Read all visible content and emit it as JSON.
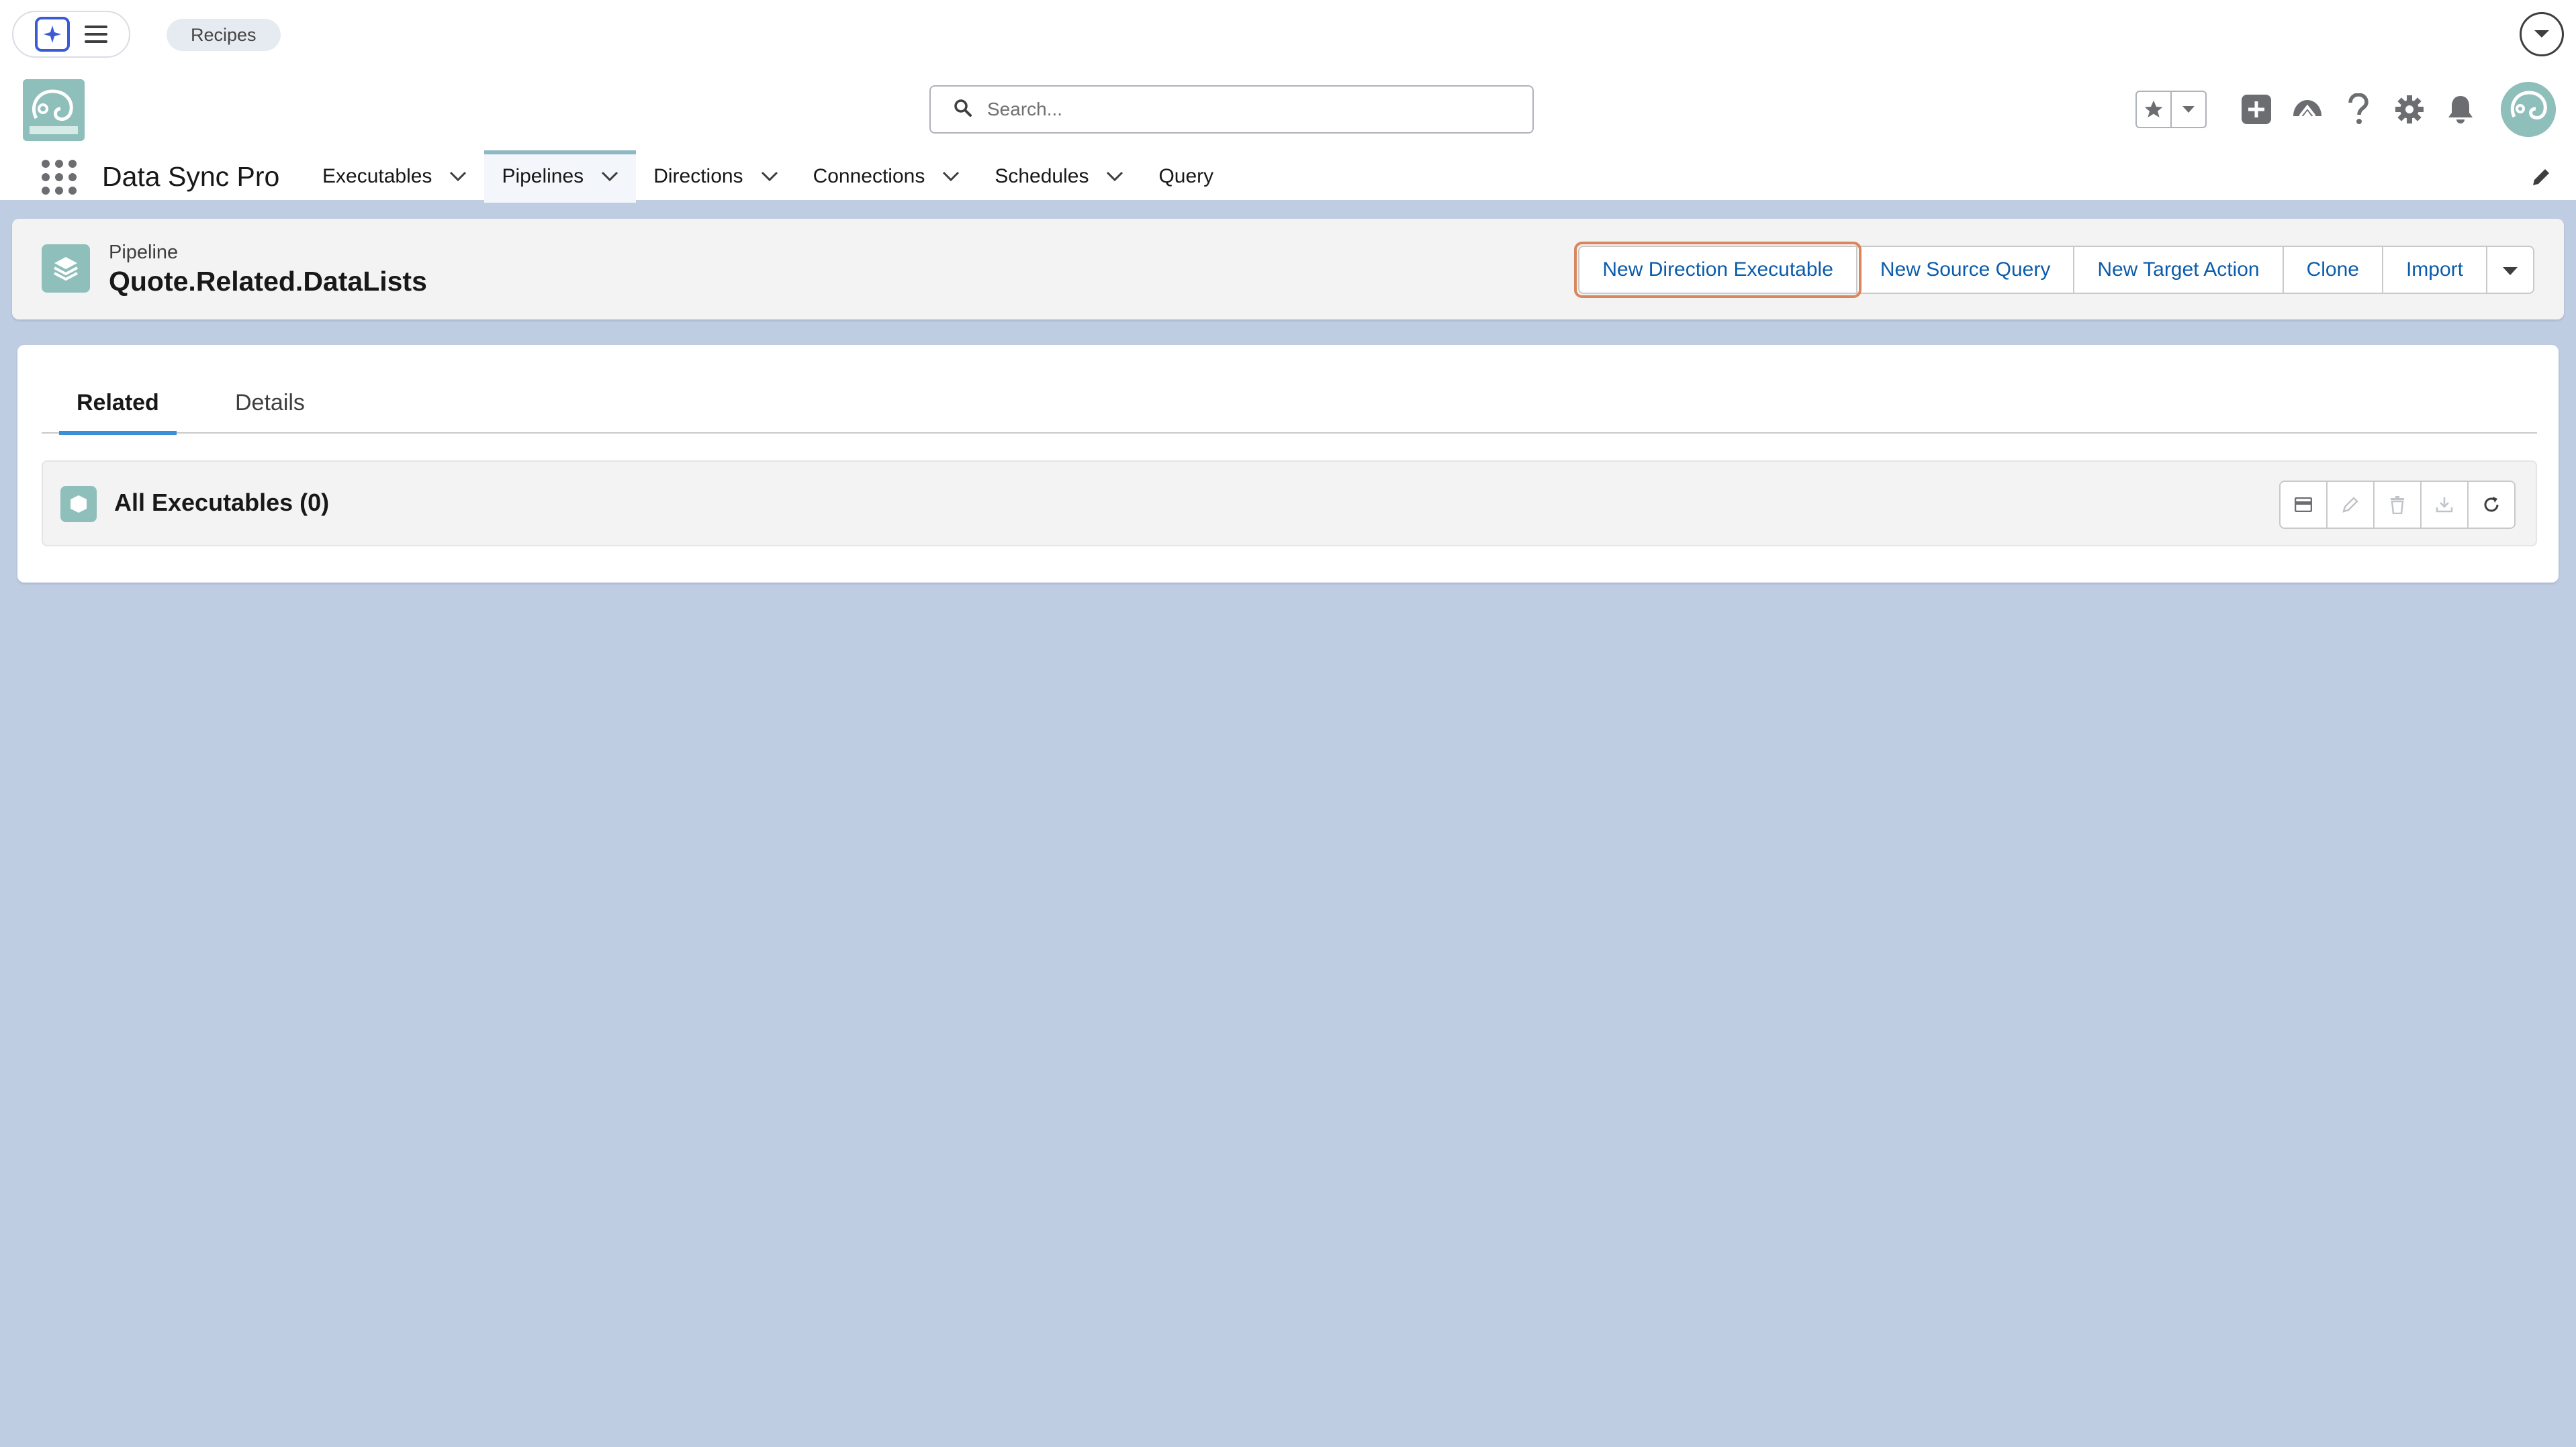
{
  "utility_bar": {
    "recipes_label": "Recipes"
  },
  "header": {
    "search_placeholder": "Search..."
  },
  "nav": {
    "app_name": "Data Sync Pro",
    "items": [
      {
        "label": "Executables",
        "has_menu": true,
        "active": false
      },
      {
        "label": "Pipelines",
        "has_menu": true,
        "active": true
      },
      {
        "label": "Directions",
        "has_menu": true,
        "active": false
      },
      {
        "label": "Connections",
        "has_menu": true,
        "active": false
      },
      {
        "label": "Schedules",
        "has_menu": true,
        "active": false
      },
      {
        "label": "Query",
        "has_menu": false,
        "active": false
      }
    ]
  },
  "record": {
    "object_type": "Pipeline",
    "title": "Quote.Related.DataLists",
    "actions": [
      "New Direction Executable",
      "New Source Query",
      "New Target Action",
      "Clone",
      "Import"
    ]
  },
  "tabs": {
    "related": "Related",
    "details": "Details",
    "active": "Related"
  },
  "related_list": {
    "title": "All Executables (0)"
  },
  "colors": {
    "page_bg": "#bfcde3",
    "brand_teal": "#8fbfbb",
    "link_blue": "#0b5cab",
    "focus_outline": "#d9865b",
    "tab_underline": "#3b8fd6"
  }
}
